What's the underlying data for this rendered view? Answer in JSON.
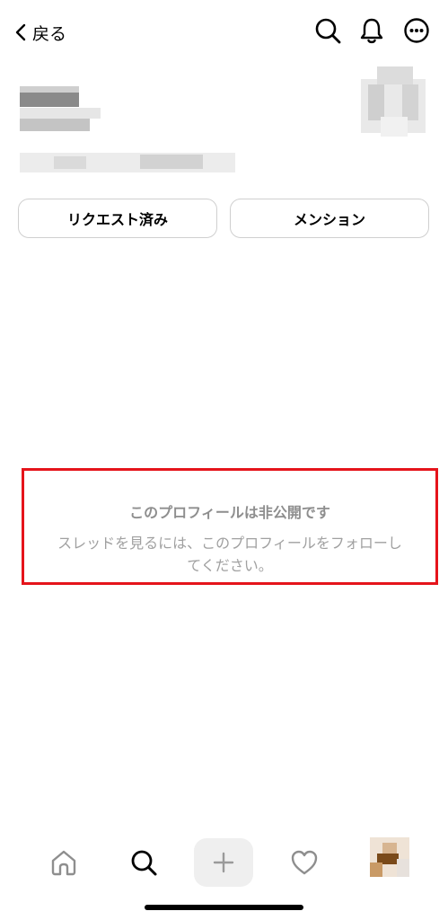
{
  "header": {
    "back_label": "戻る",
    "icons": [
      "search-icon",
      "bell-icon",
      "more-icon"
    ]
  },
  "actions": {
    "requested_label": "リクエスト済み",
    "mention_label": "メンション"
  },
  "private_notice": {
    "title": "このプロフィールは非公開です",
    "body_line1": "スレッドを見るには、このプロフィールをフォローし",
    "body_line2": "てください。"
  },
  "bottom_nav": {
    "items": [
      "home-icon",
      "search-icon",
      "plus-icon",
      "heart-icon",
      "profile-avatar"
    ]
  },
  "colors": {
    "highlight_border": "#e5141b",
    "muted_text": "#8e8e8e"
  }
}
